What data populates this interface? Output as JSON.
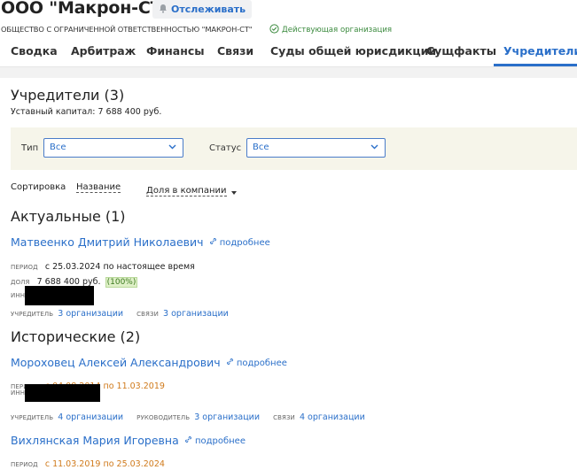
{
  "header": {
    "company_name": "ООО \"Макрон-СТ\"",
    "follow_label": "Отслеживать",
    "full_name": "ОБЩЕСТВО С ОГРАНИЧЕННОЙ ОТВЕТСТВЕННОСТЬЮ \"МАКРОН-СТ\"",
    "status": "Действующая организация"
  },
  "tabs": [
    {
      "label": "Сводка"
    },
    {
      "label": "Арбитраж"
    },
    {
      "label": "Финансы"
    },
    {
      "label": "Связи"
    },
    {
      "label": "Суды общей юрисдикции"
    },
    {
      "label": "Сущфакты"
    },
    {
      "label": "Учредители"
    }
  ],
  "founders": {
    "heading": "Учредители (3)",
    "capital": "Уставный капитал: 7 688 400 руб."
  },
  "filters": {
    "type_label": "Тип",
    "type_value": "Все",
    "status_label": "Статус",
    "status_value": "Все"
  },
  "sorting": {
    "label": "Сортировка",
    "by_name": "Название",
    "by_share": "Доля в компании"
  },
  "actual": {
    "heading": "Актуальные (1)",
    "person": {
      "name": "Матвеенко Дмитрий Николаевич",
      "more": "подробнее",
      "period_caption": "период",
      "period": "с 25.03.2024 по настоящее время",
      "share_caption": "доля",
      "share": "7 688 400 руб.",
      "share_pct": "(100%)",
      "inn_caption": "ИНН",
      "founder_caption": "учредитель",
      "founder_link": "3 организации",
      "links_caption": "связи",
      "links_link": "3 организации"
    }
  },
  "historic": {
    "heading": "Исторические (2)",
    "persons": [
      {
        "name": "Мороховец Алексей Александрович",
        "more": "подробнее",
        "period_caption": "период",
        "period": "с 04.08.2014 по 11.03.2019",
        "inn_caption": "ИНН",
        "founder_caption": "учредитель",
        "founder_link": "4 организации",
        "head_caption": "руководитель",
        "head_link": "3 организации",
        "links_caption": "связи",
        "links_link": "4 организации"
      },
      {
        "name": "Вихлянская Мария Игоревна",
        "more": "подробнее",
        "period_caption": "период",
        "period": "с 11.03.2019 по 25.03.2024"
      }
    ]
  }
}
